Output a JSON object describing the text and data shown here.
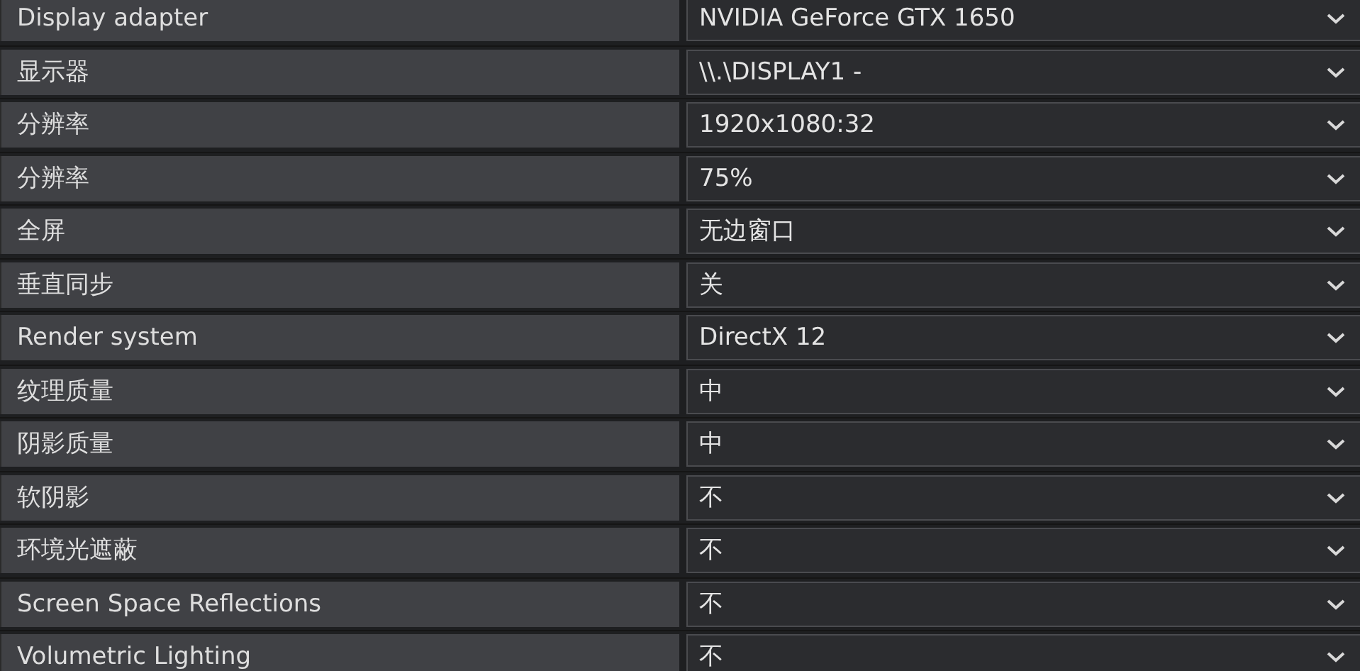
{
  "settings": [
    {
      "label": "Display adapter",
      "value": "NVIDIA GeForce GTX 1650"
    },
    {
      "label": "显示器",
      "value": "\\\\.\\DISPLAY1 -"
    },
    {
      "label": "分辨率",
      "value": "1920x1080:32"
    },
    {
      "label": "分辨率",
      "value": "75%"
    },
    {
      "label": "全屏",
      "value": "无边窗口"
    },
    {
      "label": "垂直同步",
      "value": "关"
    },
    {
      "label": "Render system",
      "value": "DirectX 12"
    },
    {
      "label": "纹理质量",
      "value": "中"
    },
    {
      "label": "阴影质量",
      "value": "中"
    },
    {
      "label": "软阴影",
      "value": "不"
    },
    {
      "label": "环境光遮蔽",
      "value": "不"
    },
    {
      "label": "Screen Space Reflections",
      "value": "不"
    },
    {
      "label": "Volumetric Lighting",
      "value": "不"
    }
  ]
}
